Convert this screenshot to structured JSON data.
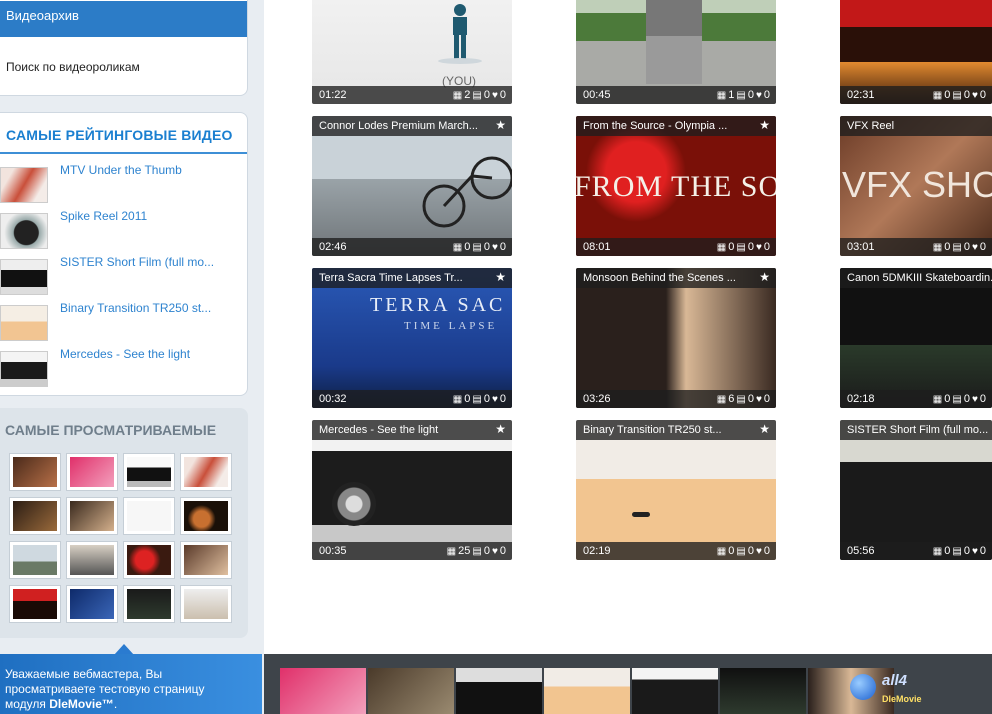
{
  "nav": {
    "active": "Видеоархив",
    "search": "Поиск по видеороликам"
  },
  "rated": {
    "title": "САМЫЕ РЕЙТИНГОВЫЕ ВИДЕО",
    "items": [
      {
        "label": "MTV Under the Thumb"
      },
      {
        "label": "Spike Reel 2011"
      },
      {
        "label": "SISTER Short Film (full mo..."
      },
      {
        "label": "Binary Transition TR250 st..."
      },
      {
        "label": "Mercedes - See the light"
      }
    ]
  },
  "viewed": {
    "title": "САМЫЕ ПРОСМАТРИВАЕМЫЕ"
  },
  "notice": {
    "line1": "Уважаемые вебмастера, Вы",
    "line2": "просматриваете тестовую страницу",
    "line3_prefix": "модуля ",
    "line3_bold": "DleMovie™",
    "line3_suffix": "."
  },
  "cards": [
    {
      "title": "",
      "duration": "01:22",
      "shots": "2",
      "comments": "0",
      "likes": "0"
    },
    {
      "title": "",
      "duration": "00:45",
      "shots": "1",
      "comments": "0",
      "likes": "0"
    },
    {
      "title": "",
      "duration": "02:31",
      "shots": "0",
      "comments": "0",
      "likes": "0"
    },
    {
      "title": "Connor Lodes Premium March...",
      "duration": "02:46",
      "shots": "0",
      "comments": "0",
      "likes": "0"
    },
    {
      "title": "From the Source - Olympia ...",
      "duration": "08:01",
      "shots": "0",
      "comments": "0",
      "likes": "0"
    },
    {
      "title": "VFX Reel",
      "duration": "03:01",
      "shots": "0",
      "comments": "0",
      "likes": "0"
    },
    {
      "title": "Terra Sacra Time Lapses Tr...",
      "duration": "00:32",
      "shots": "0",
      "comments": "0",
      "likes": "0"
    },
    {
      "title": "Monsoon Behind the Scenes ...",
      "duration": "03:26",
      "shots": "6",
      "comments": "0",
      "likes": "0"
    },
    {
      "title": "Canon 5DMKIII Skateboardin...",
      "duration": "02:18",
      "shots": "0",
      "comments": "0",
      "likes": "0"
    },
    {
      "title": "Mercedes - See the light",
      "duration": "00:35",
      "shots": "25",
      "comments": "0",
      "likes": "0"
    },
    {
      "title": "Binary Transition TR250 st...",
      "duration": "02:19",
      "shots": "0",
      "comments": "0",
      "likes": "0"
    },
    {
      "title": "SISTER Short Film (full mo...",
      "duration": "05:56",
      "shots": "0",
      "comments": "0",
      "likes": "0"
    }
  ],
  "card_overlays": {
    "you": "(YOU)",
    "from": "FROM THE SO",
    "vfx": "VFX SHO",
    "terra1": "TERRA SAC",
    "terra2": "TIME LAPSE"
  },
  "icons": {
    "star": "star-icon",
    "shots": "film-icon",
    "comments": "comment-icon",
    "likes": "heart-icon"
  },
  "watermark": {
    "logo": "all4",
    "sub": "DleMovie"
  }
}
